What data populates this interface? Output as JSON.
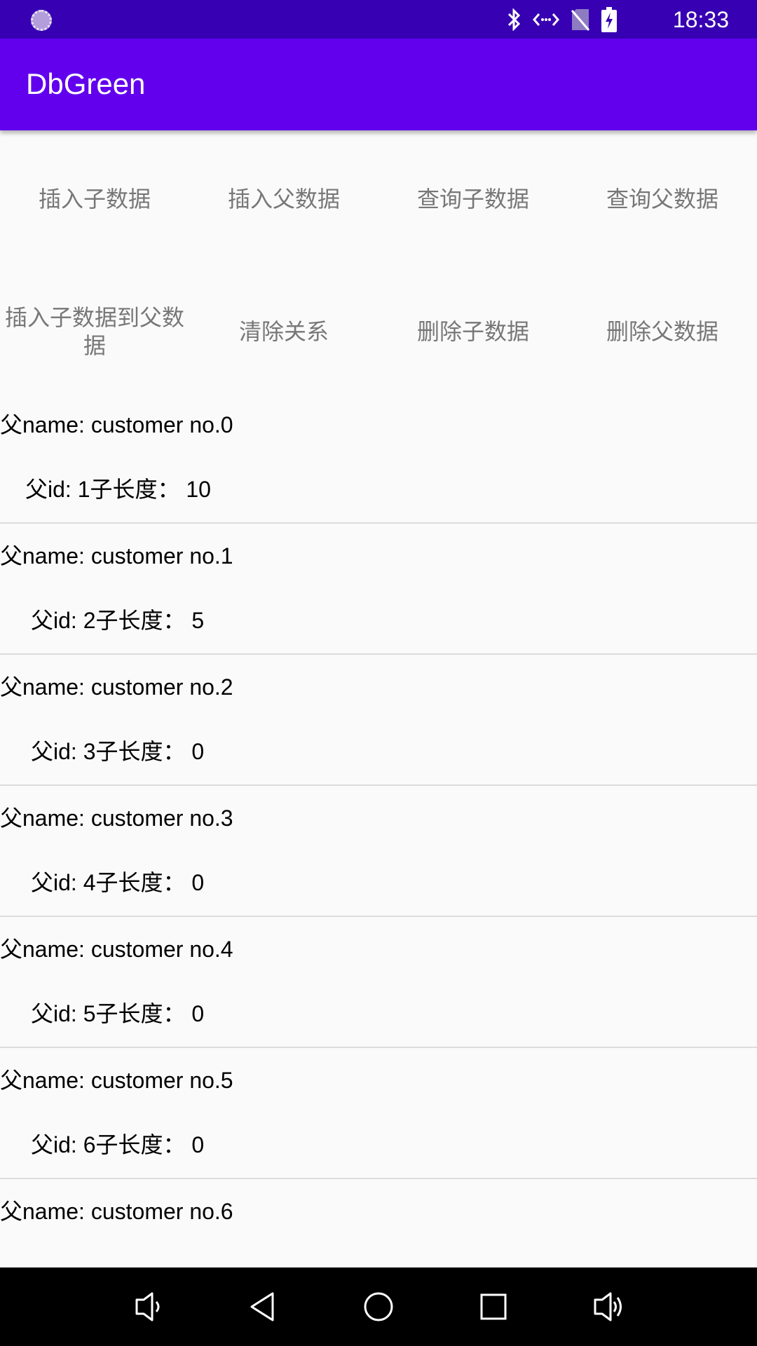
{
  "status_bar": {
    "time": "18:33",
    "icons": [
      "loading-icon",
      "bluetooth-icon",
      "data-arrows-icon",
      "no-sim-icon",
      "battery-charging-icon"
    ]
  },
  "app_bar": {
    "title": "DbGreen"
  },
  "buttons": {
    "row1": [
      "插入子数据",
      "插入父数据",
      "查询子数据",
      "查询父数据"
    ],
    "row2": [
      "插入子数据到父数据",
      "清除关系",
      "删除子数据",
      "删除父数据"
    ]
  },
  "list": {
    "items": [
      {
        "name": "父name: customer no.0",
        "info": "父id: 1子长度： 10"
      },
      {
        "name": "父name: customer no.1",
        "info": "父id: 2子长度： 5"
      },
      {
        "name": "父name: customer no.2",
        "info": "父id: 3子长度： 0"
      },
      {
        "name": "父name: customer no.3",
        "info": "父id: 4子长度： 0"
      },
      {
        "name": "父name: customer no.4",
        "info": "父id: 5子长度： 0"
      },
      {
        "name": "父name: customer no.5",
        "info": "父id: 6子长度： 0"
      },
      {
        "name": "父name: customer no.6",
        "info": ""
      }
    ]
  },
  "nav_bar": {
    "icons": [
      "volume-down-icon",
      "back-icon",
      "home-icon",
      "recents-icon",
      "volume-up-icon"
    ]
  },
  "colors": {
    "status_bar": "#3700b3",
    "app_bar": "#6200ee",
    "background": "#fafafa",
    "button_text": "#777777",
    "nav_bar": "#000000"
  }
}
